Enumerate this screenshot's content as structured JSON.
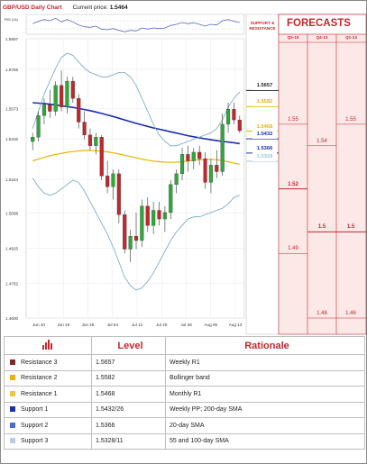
{
  "header": {
    "title": "GBP/USD Daily Chart",
    "price_label": "Current price:",
    "price_value": "1.5464"
  },
  "rsi_label": "RSI (14)",
  "forecast": {
    "title": "FORECASTS",
    "sr_label_line1": "SUPPORT &",
    "sr_label_line2": "RESISTANCE",
    "columns": [
      "Q3-15",
      "Q4-13",
      "Q1-14"
    ],
    "values": [
      {
        "col": 0,
        "text": "1.55",
        "y": 1.55
      },
      {
        "col": 0,
        "text": "1.52",
        "y": 1.52,
        "bold": true
      },
      {
        "col": 0,
        "text": "1.49",
        "y": 1.49
      },
      {
        "col": 1,
        "text": "1.54",
        "y": 1.54
      },
      {
        "col": 1,
        "text": "1.5",
        "y": 1.5,
        "bold": true
      },
      {
        "col": 1,
        "text": "1.46",
        "y": 1.46
      },
      {
        "col": 2,
        "text": "1.55",
        "y": 1.55
      },
      {
        "col": 2,
        "text": "1.5",
        "y": 1.5,
        "bold": true
      },
      {
        "col": 2,
        "text": "1.46",
        "y": 1.46
      }
    ]
  },
  "levels_boxes": [
    {
      "text": "1.5657",
      "value": 1.5657,
      "color": "#222222"
    },
    {
      "text": "1.5582",
      "value": 1.5582,
      "color": "#e8b400"
    },
    {
      "text": "1.5468",
      "value": 1.5468,
      "color": "#e8b400"
    },
    {
      "text": "1.5432",
      "value": 1.5432,
      "color": "#1a2fb0"
    },
    {
      "text": "1.5366",
      "value": 1.5366,
      "color": "#1a2fb0"
    },
    {
      "text": "1.5328",
      "value": 1.5328,
      "color": "#9fc6e0"
    }
  ],
  "chart_data": {
    "type": "line",
    "subtype": "candlestick",
    "title": "GBP/USD Daily Chart",
    "x_ticks": [
      "Jun 10",
      "Jun 18",
      "Jun 26",
      "Jul 04",
      "Jul 12",
      "Jul 20",
      "Jul 28",
      "Aug 05",
      "Aug 13"
    ],
    "y_ticks": [
      "1.5897",
      "1.5755",
      "1.5573",
      "1.5432",
      "1.5244",
      "1.5088",
      "1.4925",
      "1.4762",
      "1.4600"
    ],
    "ylim": [
      1.46,
      1.5897
    ],
    "candles": [
      [
        1.542,
        1.546,
        1.538,
        1.544
      ],
      [
        1.544,
        1.556,
        1.542,
        1.554
      ],
      [
        1.554,
        1.562,
        1.55,
        1.559
      ],
      [
        1.559,
        1.566,
        1.553,
        1.556
      ],
      [
        1.556,
        1.57,
        1.554,
        1.568
      ],
      [
        1.568,
        1.575,
        1.556,
        1.558
      ],
      [
        1.558,
        1.572,
        1.555,
        1.57
      ],
      [
        1.57,
        1.572,
        1.56,
        1.562
      ],
      [
        1.562,
        1.564,
        1.548,
        1.551
      ],
      [
        1.551,
        1.556,
        1.543,
        1.545
      ],
      [
        1.545,
        1.548,
        1.538,
        1.54
      ],
      [
        1.54,
        1.546,
        1.536,
        1.544
      ],
      [
        1.544,
        1.545,
        1.524,
        1.526
      ],
      [
        1.526,
        1.533,
        1.518,
        1.521
      ],
      [
        1.521,
        1.529,
        1.515,
        1.527
      ],
      [
        1.527,
        1.529,
        1.504,
        1.508
      ],
      [
        1.508,
        1.51,
        1.49,
        1.492
      ],
      [
        1.492,
        1.501,
        1.486,
        1.498
      ],
      [
        1.498,
        1.509,
        1.492,
        1.496
      ],
      [
        1.496,
        1.515,
        1.493,
        1.512
      ],
      [
        1.512,
        1.516,
        1.5,
        1.503
      ],
      [
        1.503,
        1.514,
        1.499,
        1.51
      ],
      [
        1.51,
        1.514,
        1.503,
        1.506
      ],
      [
        1.506,
        1.512,
        1.5,
        1.509
      ],
      [
        1.509,
        1.524,
        1.506,
        1.522
      ],
      [
        1.522,
        1.529,
        1.518,
        1.527
      ],
      [
        1.527,
        1.539,
        1.524,
        1.536
      ],
      [
        1.536,
        1.54,
        1.528,
        1.533
      ],
      [
        1.533,
        1.539,
        1.529,
        1.537
      ],
      [
        1.537,
        1.54,
        1.531,
        1.534
      ],
      [
        1.534,
        1.537,
        1.52,
        1.523
      ],
      [
        1.523,
        1.534,
        1.518,
        1.531
      ],
      [
        1.531,
        1.538,
        1.525,
        1.528
      ],
      [
        1.528,
        1.555,
        1.526,
        1.55
      ],
      [
        1.55,
        1.56,
        1.546,
        1.557
      ],
      [
        1.557,
        1.56,
        1.55,
        1.552
      ],
      [
        1.552,
        1.554,
        1.546,
        1.547
      ]
    ],
    "series": [
      {
        "name": "200-day SMA",
        "color": "#1a2fb0",
        "values": [
          1.56,
          1.5598,
          1.5596,
          1.5593,
          1.559,
          1.5586,
          1.5582,
          1.5578,
          1.5573,
          1.5568,
          1.5563,
          1.5557,
          1.555,
          1.5543,
          1.5536,
          1.5528,
          1.552,
          1.5512,
          1.5504,
          1.5497,
          1.549,
          1.5483,
          1.5477,
          1.5471,
          1.5465,
          1.5459,
          1.5453,
          1.5447,
          1.5442,
          1.5437,
          1.5432,
          1.5428,
          1.5424,
          1.542,
          1.5417,
          1.5414,
          1.541
        ]
      },
      {
        "name": "55 and 100-day SMA",
        "color": "#e8b400",
        "values": [
          1.533,
          1.5338,
          1.5346,
          1.5354,
          1.536,
          1.5365,
          1.537,
          1.5373,
          1.5376,
          1.5378,
          1.5378,
          1.5377,
          1.5375,
          1.5372,
          1.5367,
          1.5362,
          1.5356,
          1.535,
          1.5344,
          1.5338,
          1.5333,
          1.5329,
          1.5326,
          1.5324,
          1.5323,
          1.5324,
          1.5326,
          1.5329,
          1.5332,
          1.5335,
          1.5337,
          1.5337,
          1.5335,
          1.5331,
          1.5326,
          1.532,
          1.5314
        ]
      },
      {
        "name": "Bollinger band upper",
        "color": "#6fa6c8",
        "values": [
          1.548,
          1.556,
          1.564,
          1.57,
          1.576,
          1.581,
          1.583,
          1.582,
          1.579,
          1.576,
          1.574,
          1.573,
          1.572,
          1.572,
          1.573,
          1.574,
          1.574,
          1.572,
          1.568,
          1.562,
          1.556,
          1.55,
          1.545,
          1.542,
          1.54,
          1.54,
          1.541,
          1.542,
          1.543,
          1.544,
          1.545,
          1.546,
          1.548,
          1.552,
          1.558,
          1.562,
          1.565
        ]
      },
      {
        "name": "Bollinger band lower",
        "color": "#6fa6c8",
        "values": [
          1.525,
          1.521,
          1.518,
          1.517,
          1.518,
          1.52,
          1.522,
          1.524,
          1.523,
          1.519,
          1.514,
          1.509,
          1.504,
          1.499,
          1.493,
          1.486,
          1.479,
          1.475,
          1.473,
          1.474,
          1.477,
          1.481,
          1.486,
          1.491,
          1.496,
          1.5,
          1.503,
          1.506,
          1.507,
          1.507,
          1.508,
          1.509,
          1.51,
          1.511,
          1.513,
          1.516,
          1.517
        ]
      }
    ]
  },
  "table": {
    "headers": [
      "",
      "Level",
      "Rationale"
    ],
    "rows": [
      {
        "name": "Resistance 3",
        "level": "1.5657",
        "rationale": "Weekly R1",
        "color": "#7a2a2a"
      },
      {
        "name": "Resistance 2",
        "level": "1.5582",
        "rationale": "Bollinger band",
        "color": "#e8b400"
      },
      {
        "name": "Resistance 1",
        "level": "1.5468",
        "rationale": "Monthly R1",
        "color": "#f4c542"
      },
      {
        "name": "Support 1",
        "level": "1.5432/26",
        "rationale": "Weekly PP; 200-day SMA",
        "color": "#1a2fb0"
      },
      {
        "name": "Support 2",
        "level": "1.5366",
        "rationale": "20-day SMA",
        "color": "#4a6fc8"
      },
      {
        "name": "Support 3",
        "level": "1.5328/11",
        "rationale": "55 and 100-day SMA",
        "color": "#b7cde6"
      }
    ]
  }
}
